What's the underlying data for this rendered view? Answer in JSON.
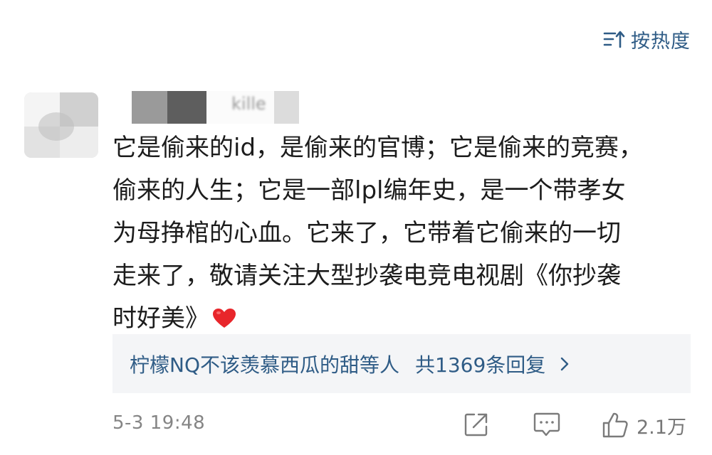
{
  "sort": {
    "label": "按热度",
    "icon": "sort-icon"
  },
  "comment": {
    "author": "kille",
    "lines": [
      "它是偷来的id，是偷来的官博；它是偷来的竞赛，",
      "偷来的人生；它是一部lpl编年史，是一个带孝女",
      "为母挣棺的心血。它来了，它带着它偷来的一切",
      "走来了，敬请关注大型抄袭电竞电视剧《你抄袭",
      "时好美》"
    ],
    "emoji": "heart-icon"
  },
  "replies": {
    "who": "柠檬NQ不该羡慕西瓜的甜等人",
    "count": "共1369条回复",
    "icon": "chevron-right-icon"
  },
  "footer": {
    "timestamp": "5-3 19:48",
    "like_count": "2.1万",
    "icons": [
      "share-icon",
      "comment-icon",
      "like-icon"
    ]
  },
  "colors": {
    "link": "#2f5c86",
    "text": "#1c1c1c",
    "muted": "#858585",
    "reply_bg": "#f4f5f7",
    "heart": "#e8262b"
  }
}
